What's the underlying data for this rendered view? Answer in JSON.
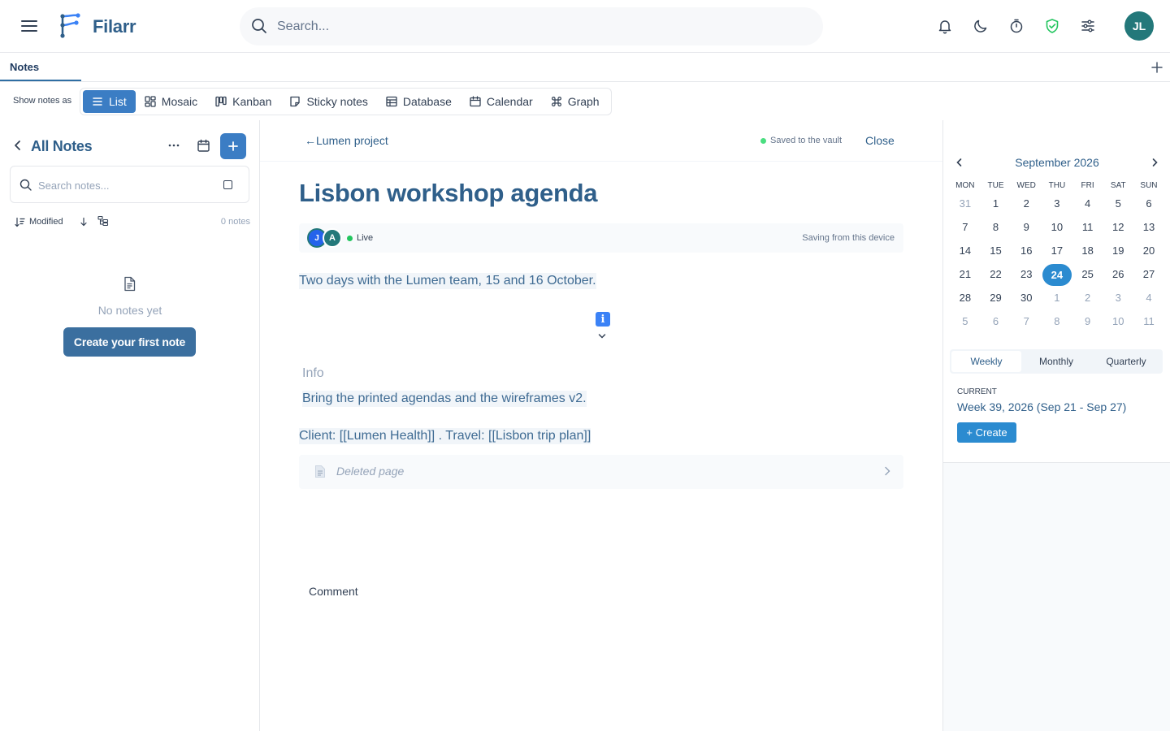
{
  "app": {
    "brand": "Filarr",
    "avatar_initials": "JL",
    "accent": "#3b7dc4",
    "brand_color": "#2f5f8a"
  },
  "search": {
    "placeholder": "Search..."
  },
  "tabs": {
    "active": "Notes"
  },
  "viewbar": {
    "label": "Show notes as",
    "views": [
      "List",
      "Mosaic",
      "Kanban",
      "Sticky notes",
      "Database",
      "Calendar",
      "Graph"
    ],
    "active_view": "List"
  },
  "sidebar": {
    "title": "All Notes",
    "search_placeholder": "Search notes...",
    "sort_label": "Modified",
    "count": "0 notes",
    "empty_text": "No notes yet",
    "create_first": "Create your first note"
  },
  "note": {
    "back_label": "←Lumen project",
    "saved_status": "Saved to the vault",
    "close_label": "Close",
    "title": "Lisbon workshop agenda",
    "avatars": [
      "J",
      "A"
    ],
    "live_label": "Live",
    "saving_label": "Saving from this device",
    "line1": "Two days with the Lumen team, 15 and 16 October.",
    "info_badge": "i",
    "info_label": "Info",
    "info_body": "Bring the printed agendas and the wireframes v2.",
    "links_line": "Client: [[Lumen Health]] . Travel: [[Lisbon trip plan]]",
    "deleted_page": "Deleted page",
    "comment_label": "Comment"
  },
  "calendar": {
    "month": "September 2026",
    "weekdays": [
      "MON",
      "TUE",
      "WED",
      "THU",
      "FRI",
      "SAT",
      "SUN"
    ],
    "weeks": [
      [
        "31",
        "1",
        "2",
        "3",
        "4",
        "5",
        "6"
      ],
      [
        "7",
        "8",
        "9",
        "10",
        "11",
        "12",
        "13"
      ],
      [
        "14",
        "15",
        "16",
        "17",
        "18",
        "19",
        "20"
      ],
      [
        "21",
        "22",
        "23",
        "24",
        "25",
        "26",
        "27"
      ],
      [
        "28",
        "29",
        "30",
        "1",
        "2",
        "3",
        "4"
      ],
      [
        "5",
        "6",
        "7",
        "8",
        "9",
        "10",
        "11"
      ]
    ],
    "muted": [
      [
        0,
        0
      ],
      [
        4,
        3
      ],
      [
        4,
        4
      ],
      [
        4,
        5
      ],
      [
        4,
        6
      ],
      [
        5,
        0
      ],
      [
        5,
        1
      ],
      [
        5,
        2
      ],
      [
        5,
        3
      ],
      [
        5,
        4
      ],
      [
        5,
        5
      ],
      [
        5,
        6
      ]
    ],
    "today": [
      3,
      3
    ],
    "periods": [
      "Weekly",
      "Monthly",
      "Quarterly"
    ],
    "active_period": "Weekly",
    "current_label": "CURRENT",
    "week_label": "Week 39, 2026 (Sep 21 - Sep 27)",
    "create_label": "+ Create"
  }
}
